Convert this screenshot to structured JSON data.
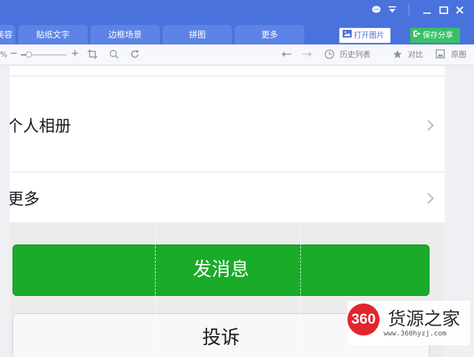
{
  "header": {
    "tabs": [
      "美容",
      "贴纸文字",
      "边框场景",
      "拼图",
      "更多"
    ],
    "open_image_label": "打开图片",
    "save_share_label": "保存分享",
    "window_controls": [
      "chat-icon",
      "dropdown-icon",
      "minimize-icon",
      "maximize-icon",
      "close-icon"
    ]
  },
  "toolbar": {
    "zoom_percent_tail": "%",
    "zoom_minus": "−",
    "zoom_plus": "+",
    "history_label": "历史列表",
    "compare_label": "对比",
    "original_label": "原图"
  },
  "phone": {
    "rows": [
      {
        "label": "个人相册"
      },
      {
        "label": "更多"
      }
    ],
    "send_message_label": "发消息",
    "report_label": "投诉"
  },
  "watermark": {
    "badge": "360",
    "name": "货源之家",
    "url": "www.360hyzj.com"
  },
  "colors": {
    "header_blue": "#4a72dd",
    "tab_blue": "#5d83e6",
    "wechat_green": "#1aab29",
    "save_green": "#39bf6a",
    "brand_red": "#e1262d"
  }
}
